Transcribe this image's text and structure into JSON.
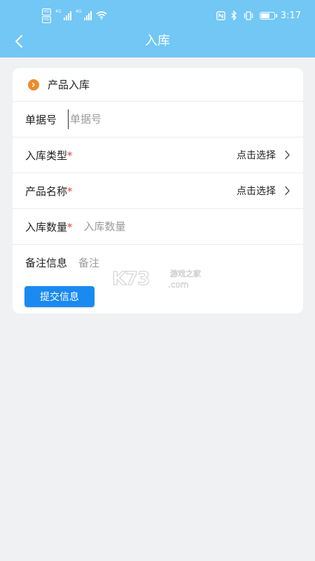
{
  "status_bar": {
    "hd_1": "HD",
    "hd_2": "HD",
    "net_1": "4G",
    "net_2": "4G",
    "time": "3:17",
    "icons": [
      "nfc-icon",
      "bluetooth-icon",
      "vibrate-icon",
      "battery-icon",
      "wifi-icon",
      "signal-icon"
    ]
  },
  "header": {
    "back_icon": "chevron-left-icon",
    "title": "入库"
  },
  "form": {
    "section_title": "产品入库",
    "section_icon": "chevron-right-circle-icon",
    "fields": {
      "doc_no": {
        "label": "单据号",
        "placeholder": "单据号",
        "value": ""
      },
      "type": {
        "label": "入库类型",
        "required_mark": "*",
        "value": "点击选择"
      },
      "product": {
        "label": "产品名称",
        "required_mark": "*",
        "value": "点击选择"
      },
      "quantity": {
        "label": "入库数量",
        "required_mark": "*",
        "placeholder": "入库数量",
        "value": ""
      },
      "remark": {
        "label": "备注信息",
        "placeholder": "备注",
        "value": ""
      }
    },
    "submit_label": "提交信息"
  },
  "watermark": {
    "logo": "K73",
    "top": "游戏之家",
    "bottom": ".com"
  },
  "colors": {
    "header_bg": "#72c7f5",
    "accent_button": "#1b8af0",
    "section_dot": "#ea8c2d",
    "required": "#e04040",
    "page_bg": "#f0f1f3"
  }
}
